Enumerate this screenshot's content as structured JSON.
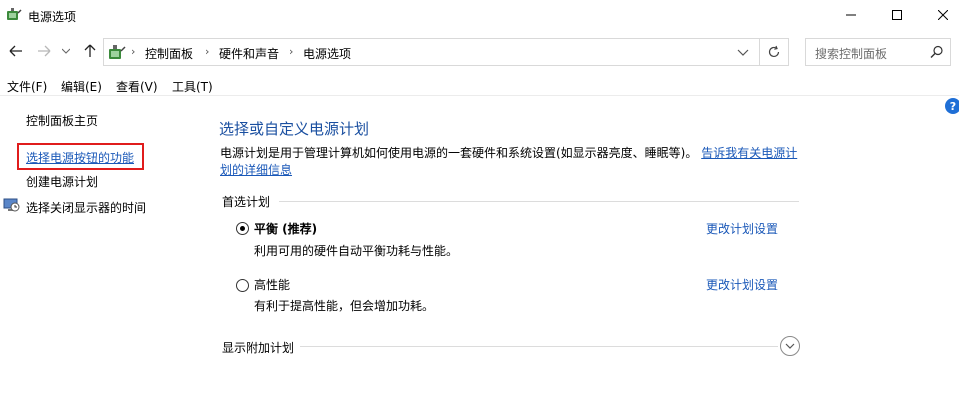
{
  "window": {
    "title": "电源选项"
  },
  "breadcrumb": [
    "控制面板",
    "硬件和声音",
    "电源选项"
  ],
  "search": {
    "placeholder": "搜索控制面板"
  },
  "menu": [
    "文件(F)",
    "编辑(E)",
    "查看(V)",
    "工具(T)"
  ],
  "sidebar": {
    "home": "控制面板主页",
    "power_button": "选择电源按钮的功能",
    "create_plan": "创建电源计划",
    "display_off": "选择关闭显示器的时间"
  },
  "main": {
    "title": "选择或自定义电源计划",
    "description": "电源计划是用于管理计算机如何使用电源的一套硬件和系统设置(如显示器亮度、睡眠等)。",
    "description_link": "告诉我有关电源计划的详细信息",
    "preferred_header": "首选计划",
    "plans": [
      {
        "name": "平衡 (推荐)",
        "desc": "利用可用的硬件自动平衡功耗与性能。",
        "link": "更改计划设置",
        "selected": true
      },
      {
        "name": "高性能",
        "desc": "有利于提高性能，但会增加功耗。",
        "link": "更改计划设置",
        "selected": false
      }
    ],
    "more_plans_header": "显示附加计划"
  },
  "colors": {
    "link": "#1a58b8",
    "title": "#1a4fa0",
    "highlight": "#e01c1c"
  },
  "icons": [
    "power-options-icon",
    "back-arrow-icon",
    "forward-arrow-icon",
    "recent-dropdown-icon",
    "up-arrow-icon",
    "refresh-icon",
    "search-icon",
    "help-icon",
    "display-clock-icon",
    "expand-icon"
  ]
}
